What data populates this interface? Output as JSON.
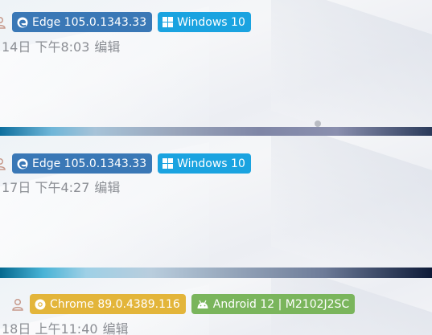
{
  "comments": [
    {
      "browser": "Edge 105.0.1343.33",
      "os": "Windows 10",
      "date": "14日 下午8:03",
      "edit_label": "编辑"
    },
    {
      "browser": "Edge 105.0.1343.33",
      "os": "Windows 10",
      "date": "17日 下午4:27",
      "edit_label": "编辑"
    },
    {
      "browser": "Chrome 89.0.4389.116",
      "os": "Android 12 | M2102J2SC",
      "date": "18日 上午11:40",
      "edit_label": "编辑"
    }
  ],
  "icons": {
    "user": "user-icon",
    "edge": "edge-icon",
    "windows": "windows-icon",
    "chrome": "chrome-icon",
    "android": "android-icon"
  },
  "colors": {
    "edge_badge": "#3a78b6",
    "windows_badge": "#1aa3e0",
    "chrome_badge": "#e3b53a",
    "android_badge": "#7ab55c",
    "meta_text": "#8b8e94"
  }
}
